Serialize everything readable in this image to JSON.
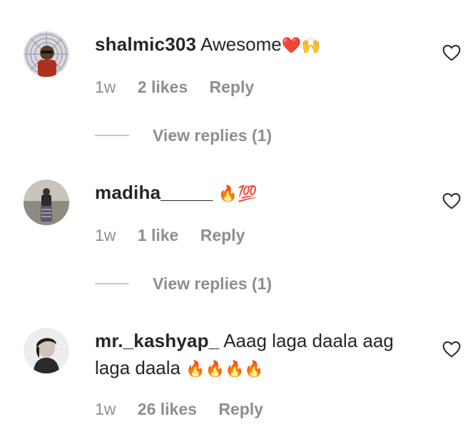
{
  "comments": [
    {
      "username": "shalmic303",
      "text": "Awesome",
      "emojis": "❤️🙌",
      "time": "1w",
      "likes": "2 likes",
      "reply": "Reply",
      "view_replies": "View replies (1)"
    },
    {
      "username": "madiha_____",
      "text": "",
      "emojis": "🔥💯",
      "time": "1w",
      "likes": "1 like",
      "reply": "Reply",
      "view_replies": "View replies (1)"
    },
    {
      "username": "mr._kashyap_",
      "text_line1": "Aaag laga daala aag",
      "text_line2": "laga daala",
      "emojis": "🔥🔥🔥🔥",
      "time": "1w",
      "likes": "26 likes",
      "reply": "Reply"
    }
  ],
  "icons": {
    "like": "heart-icon"
  },
  "colors": {
    "text": "#262626",
    "secondary": "#8e8e8e",
    "background": "#ffffff"
  }
}
